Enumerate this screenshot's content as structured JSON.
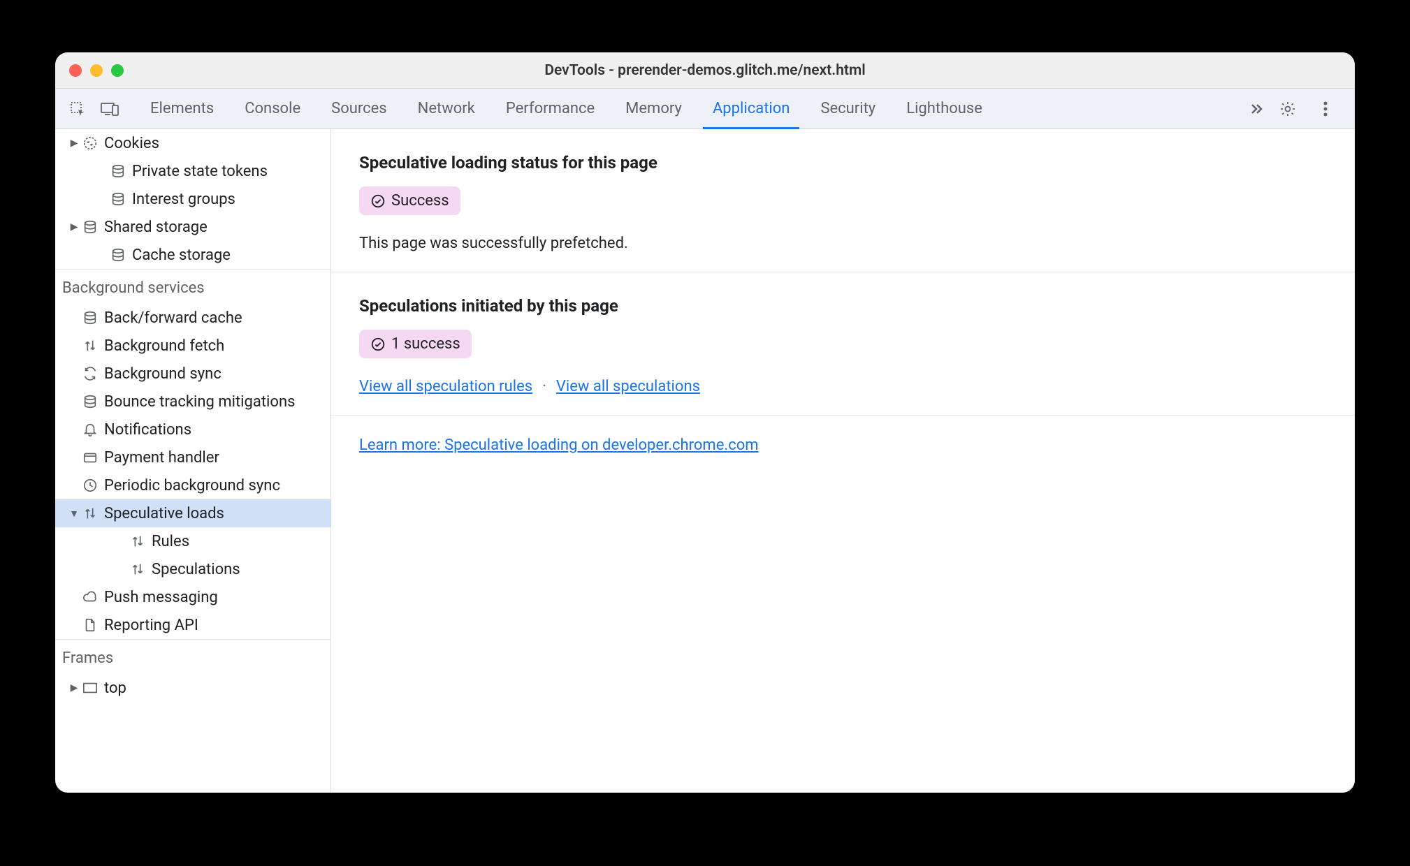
{
  "window": {
    "title": "DevTools - prerender-demos.glitch.me/next.html"
  },
  "tabs": [
    "Elements",
    "Console",
    "Sources",
    "Network",
    "Performance",
    "Memory",
    "Application",
    "Security",
    "Lighthouse"
  ],
  "active_tab": "Application",
  "sidebar": {
    "storage_items": [
      {
        "label": "Cookies",
        "icon": "cookie",
        "arrow": true,
        "indent": 0
      },
      {
        "label": "Private state tokens",
        "icon": "db",
        "arrow": false,
        "indent": 1
      },
      {
        "label": "Interest groups",
        "icon": "db",
        "arrow": false,
        "indent": 1
      },
      {
        "label": "Shared storage",
        "icon": "db",
        "arrow": true,
        "indent": 0
      },
      {
        "label": "Cache storage",
        "icon": "db",
        "arrow": false,
        "indent": 1
      }
    ],
    "bg_header": "Background services",
    "bg_items": [
      {
        "label": "Back/forward cache",
        "icon": "db",
        "arrow": false
      },
      {
        "label": "Background fetch",
        "icon": "updown",
        "arrow": false
      },
      {
        "label": "Background sync",
        "icon": "sync",
        "arrow": false
      },
      {
        "label": "Bounce tracking mitigations",
        "icon": "db",
        "arrow": false
      },
      {
        "label": "Notifications",
        "icon": "bell",
        "arrow": false
      },
      {
        "label": "Payment handler",
        "icon": "card",
        "arrow": false
      },
      {
        "label": "Periodic background sync",
        "icon": "clock",
        "arrow": false
      },
      {
        "label": "Speculative loads",
        "icon": "updown",
        "arrow": true,
        "expanded": true,
        "selected": true
      },
      {
        "label": "Rules",
        "icon": "updown",
        "arrow": false,
        "child": true
      },
      {
        "label": "Speculations",
        "icon": "updown",
        "arrow": false,
        "child": true
      },
      {
        "label": "Push messaging",
        "icon": "cloud",
        "arrow": false
      },
      {
        "label": "Reporting API",
        "icon": "file",
        "arrow": false
      }
    ],
    "frames_header": "Frames",
    "frames_items": [
      {
        "label": "top",
        "icon": "frame",
        "arrow": true
      }
    ]
  },
  "main": {
    "status_heading": "Speculative loading status for this page",
    "status_badge": "Success",
    "status_text": "This page was successfully prefetched.",
    "speculations_heading": "Speculations initiated by this page",
    "speculations_badge": "1 success",
    "link_rules": "View all speculation rules",
    "link_speculations": "View all speculations",
    "learn_more": "Learn more: Speculative loading on developer.chrome.com"
  }
}
